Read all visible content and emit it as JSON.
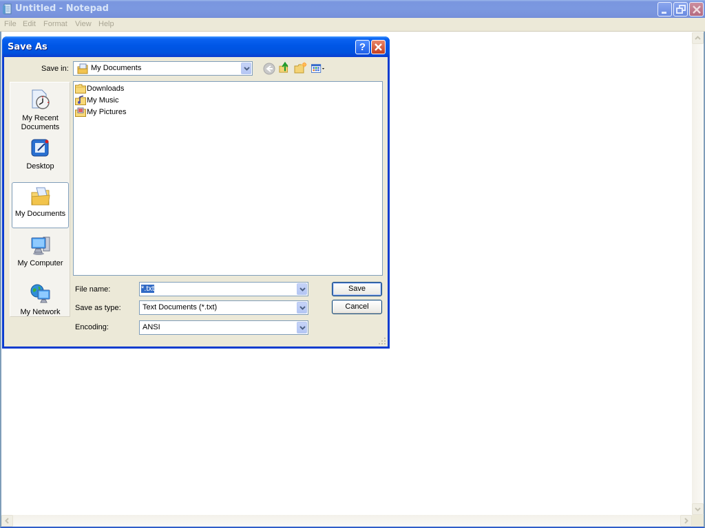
{
  "notepad": {
    "title": "Untitled - Notepad",
    "menu": [
      "File",
      "Edit",
      "Format",
      "View",
      "Help"
    ],
    "window_buttons": [
      "minimize",
      "restore",
      "close"
    ]
  },
  "dialog": {
    "title": "Save As",
    "help_button": "?",
    "save_in_label": "Save in:",
    "save_in_value": "My Documents",
    "toolbar": [
      "back",
      "up-one-level",
      "create-new-folder",
      "views-menu"
    ],
    "places": [
      {
        "label_line1": "My Recent",
        "label_line2": "Documents",
        "icon": "recent-documents-icon"
      },
      {
        "label_line1": "Desktop",
        "label_line2": "",
        "icon": "desktop-icon"
      },
      {
        "label_line1": "My Documents",
        "label_line2": "",
        "icon": "my-documents-icon",
        "selected": true
      },
      {
        "label_line1": "My Computer",
        "label_line2": "",
        "icon": "my-computer-icon"
      },
      {
        "label_line1": "My Network",
        "label_line2": "",
        "icon": "my-network-icon"
      }
    ],
    "files": [
      {
        "name": "Downloads",
        "icon": "folder-icon"
      },
      {
        "name": "My Music",
        "icon": "music-folder-icon"
      },
      {
        "name": "My Pictures",
        "icon": "pictures-folder-icon"
      }
    ],
    "file_name_label": "File name:",
    "file_name_value": "*.txt",
    "save_as_type_label": "Save as type:",
    "save_as_type_value": "Text Documents (*.txt)",
    "encoding_label": "Encoding:",
    "encoding_value": "ANSI",
    "save_button": "Save",
    "cancel_button": "Cancel"
  },
  "colors": {
    "dialog_title_blue": "#0054e3",
    "dialog_face": "#ece9d8",
    "selection": "#316ac5",
    "inactive_title": "#7a96df"
  }
}
